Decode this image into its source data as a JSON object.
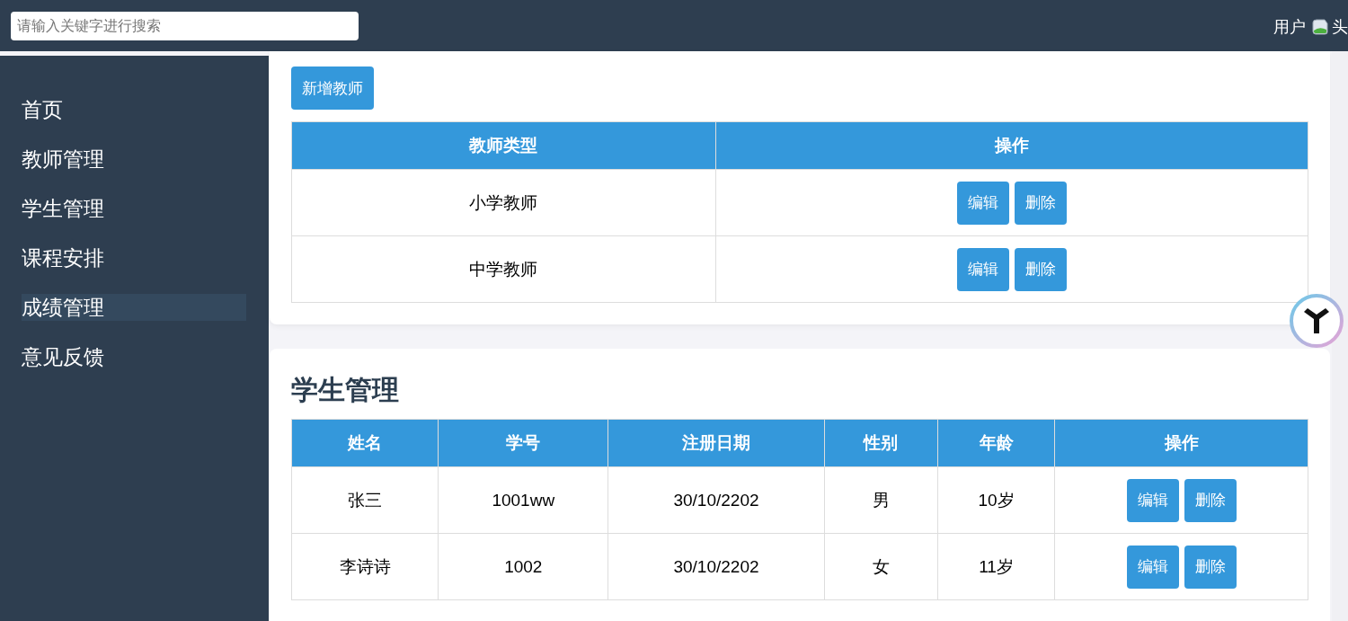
{
  "header": {
    "search": {
      "placeholder": "请输入关键字进行搜索"
    },
    "user_label": "用户",
    "avatar_alt": "头"
  },
  "sidebar": {
    "items": [
      {
        "label": "首页",
        "selected": false
      },
      {
        "label": "教师管理",
        "selected": false
      },
      {
        "label": "学生管理",
        "selected": false
      },
      {
        "label": "课程安排",
        "selected": false
      },
      {
        "label": "成绩管理",
        "selected": true
      },
      {
        "label": "意见反馈",
        "selected": false
      }
    ]
  },
  "teacher_section": {
    "add_button": "新增教师",
    "table": {
      "columns": [
        "教师类型",
        "操作"
      ],
      "rows": [
        {
          "cells": [
            "小学教师"
          ],
          "actions": [
            "编辑",
            "删除"
          ]
        },
        {
          "cells": [
            "中学教师"
          ],
          "actions": [
            "编辑",
            "删除"
          ]
        }
      ]
    }
  },
  "student_section": {
    "title": "学生管理",
    "table": {
      "columns": [
        "姓名",
        "学号",
        "注册日期",
        "性别",
        "年龄",
        "操作"
      ],
      "rows": [
        {
          "cells": [
            "张三",
            "1001ww",
            "30/10/2202",
            "男",
            "10岁"
          ],
          "actions": [
            "编辑",
            "删除"
          ]
        },
        {
          "cells": [
            "李诗诗",
            "1002",
            "30/10/2202",
            "女",
            "11岁"
          ],
          "actions": [
            "编辑",
            "删除"
          ]
        }
      ]
    }
  }
}
